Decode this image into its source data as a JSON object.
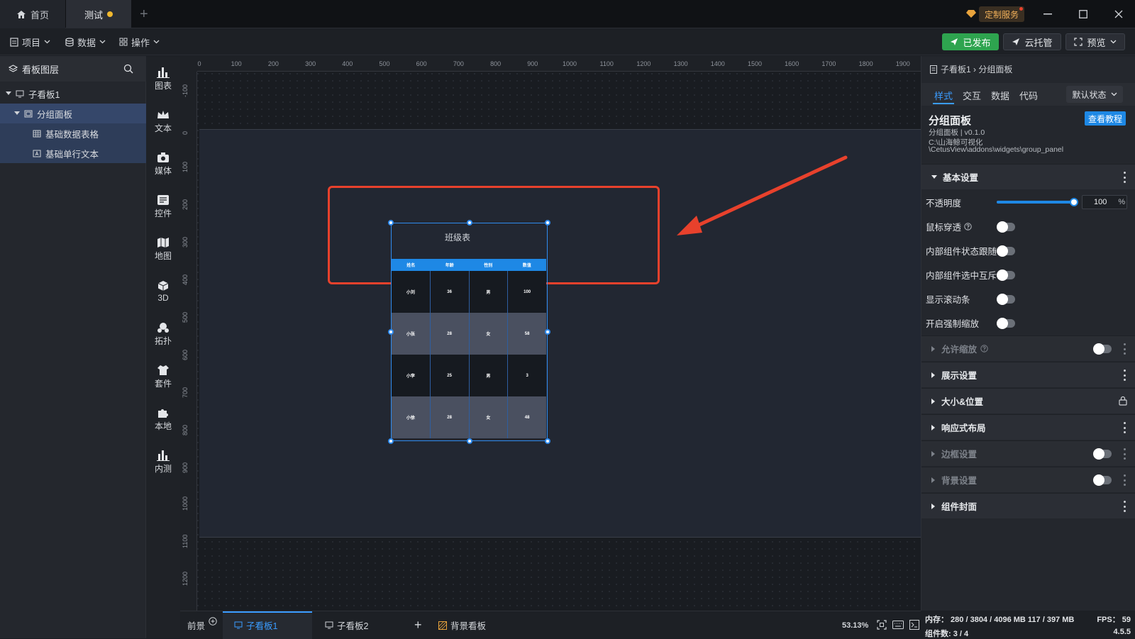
{
  "tabs": {
    "home": "首页",
    "test": "测试"
  },
  "titlebar": {
    "service": "定制服务"
  },
  "toolbar": {
    "menu_project": "项目",
    "menu_data": "数据",
    "menu_operate": "操作",
    "publish": "已发布",
    "cloud": "云托管",
    "preview": "预览"
  },
  "layers": {
    "title": "看板图层",
    "items": [
      "子看板1",
      "分组面板",
      "基础数据表格",
      "基础单行文本"
    ]
  },
  "components": [
    "图表",
    "文本",
    "媒体",
    "控件",
    "地图",
    "3D",
    "拓扑",
    "套件",
    "本地",
    "内测"
  ],
  "ruler": {
    "h": [
      "0",
      "100",
      "200",
      "300",
      "400",
      "500",
      "600",
      "700",
      "800",
      "900",
      "1000",
      "1100",
      "1200",
      "1300",
      "1400",
      "1500",
      "1600",
      "1700",
      "1800",
      "1900"
    ],
    "v": [
      "-100",
      "0",
      "100",
      "200",
      "300",
      "400",
      "500",
      "600",
      "700",
      "800",
      "900",
      "1000",
      "1100",
      "1200"
    ]
  },
  "widget": {
    "title": "班级表",
    "headers": [
      "姓名",
      "年龄",
      "性别",
      "数值"
    ],
    "rows": [
      [
        "小刘",
        "36",
        "男",
        "100"
      ],
      [
        "小张",
        "28",
        "女",
        "58"
      ],
      [
        "小李",
        "25",
        "男",
        "3"
      ],
      [
        "小徐",
        "28",
        "女",
        "48"
      ]
    ]
  },
  "right": {
    "breadcrumb": "子看板1 › 分组面板",
    "tabs": [
      "样式",
      "交互",
      "数据",
      "代码"
    ],
    "state": "默认状态",
    "name": "分组面板",
    "version": "分组面板 | v0.1.0",
    "path1": "C:\\山海鲸可视化",
    "path2": "\\CetusView\\addons\\widgets\\group_panel",
    "tutorial": "查看教程",
    "basic_section": "基本设置",
    "opacity_label": "不透明度",
    "opacity_value": "100",
    "opacity_unit": "%",
    "opacity_fraction": 1.0,
    "toggles": [
      "鼠标穿透",
      "内部组件状态跟随",
      "内部组件选中互斥",
      "显示滚动条",
      "开启强制缩放"
    ],
    "sections": [
      "允许缩放",
      "展示设置",
      "大小&位置",
      "响应式布局",
      "边框设置",
      "背景设置",
      "组件封面"
    ]
  },
  "bottom": {
    "foreground": "前景",
    "board1": "子看板1",
    "board2": "子看板2",
    "add": "+",
    "background": "背景看板",
    "zoom": "53.13%"
  },
  "status": {
    "memory": "内存： 280 / 3804 / 4096 MB  117 / 397 MB",
    "fps": "FPS： 59",
    "count": "组件数: 3 / 4",
    "version": "4.5.5"
  },
  "colors": {
    "accent": "#1e88e5",
    "publish": "#2ea44f",
    "annotation": "#e8412c",
    "selected": "#35476a"
  }
}
